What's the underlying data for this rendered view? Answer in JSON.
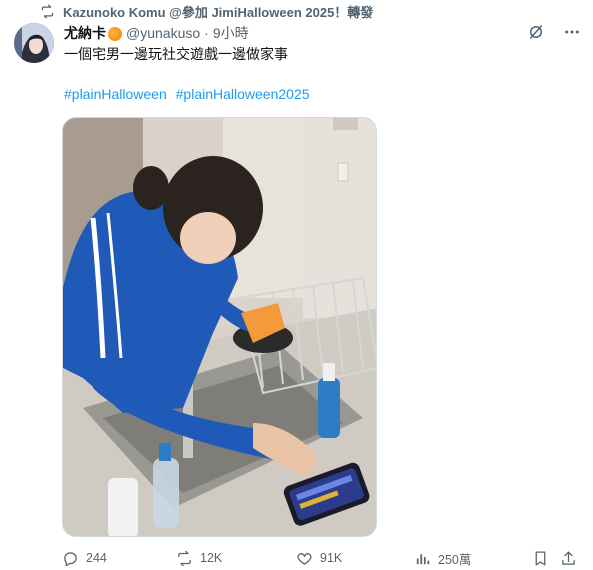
{
  "retweet": {
    "text": "Kazunoko Komu @參加 JimiHalloween 2025！轉發",
    "icon": "retweet-icon"
  },
  "tweet": {
    "author": {
      "display_name": "尤納卡",
      "handle": "@yunakuso",
      "avatar": "avatar"
    },
    "separator": "·",
    "time": "9小時",
    "text": "一個宅男一邊玩社交遊戲一邊做家事",
    "hashtags": [
      "#plainHalloween",
      "#plainHalloween2025"
    ],
    "media_alt": "woman in blue track jacket washing dishes at kitchen sink while looking at smartphone game",
    "actions": {
      "reply_count": "244",
      "retweet_count": "12K",
      "like_count": "91K",
      "view_count": "250萬"
    }
  },
  "colors": {
    "link": "#1d9bf0",
    "secondary_text": "#536471",
    "primary_text": "#0f1419"
  }
}
